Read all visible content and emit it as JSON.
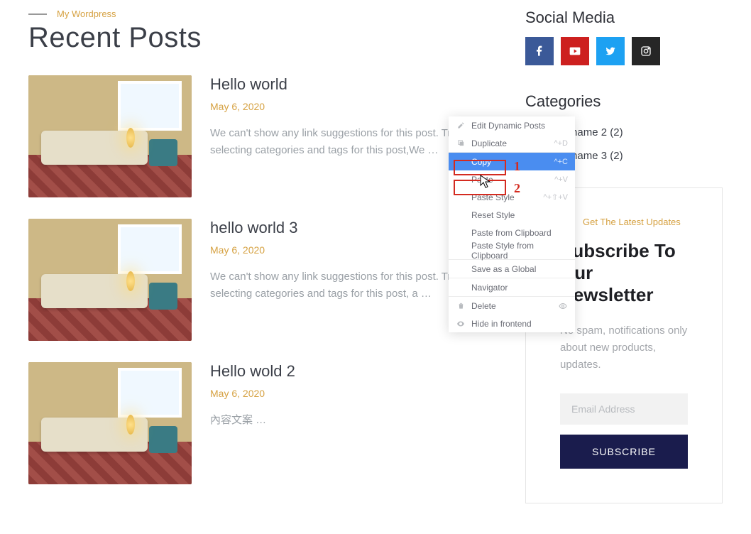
{
  "header": {
    "eyebrow": "My Wordpress",
    "title": "Recent Posts"
  },
  "posts": [
    {
      "title": "Hello world",
      "date": "May 6, 2020",
      "excerpt": "We can't show any link suggestions for this post. Try selecting categories and tags for this post,We …"
    },
    {
      "title": "hello world 3",
      "date": "May 6, 2020",
      "excerpt": "We can't show any link suggestions for this post. Try selecting categories and tags for this post, a …"
    },
    {
      "title": "Hello wold 2",
      "date": "May 6, 2020",
      "excerpt": "內容文案 …"
    }
  ],
  "sidebar": {
    "social_title": "Social Media",
    "categories_title": "Categories",
    "categories": [
      "Category name 2 (2)",
      "Category name 3 (2)"
    ]
  },
  "newsletter": {
    "eyebrow": "Get The Latest Updates",
    "title": "Subscribe To Our Newsletter",
    "desc": "No spam, notifications only about new products, updates.",
    "placeholder": "Email Address",
    "button": "SUBSCRIBE"
  },
  "context_menu": {
    "items": [
      {
        "key": "edit",
        "label": "Edit Dynamic Posts",
        "shortcut": "",
        "icon": "pencil"
      },
      {
        "key": "duplicate",
        "label": "Duplicate",
        "shortcut": "^+D",
        "icon": "copy"
      },
      {
        "key": "copy",
        "label": "Copy",
        "shortcut": "^+C",
        "icon": "",
        "selected": true
      },
      {
        "key": "paste",
        "label": "Paste",
        "shortcut": "^+V",
        "icon": ""
      },
      {
        "key": "paste-style",
        "label": "Paste Style",
        "shortcut": "^+⇧+V",
        "icon": ""
      },
      {
        "key": "reset-style",
        "label": "Reset Style",
        "shortcut": "",
        "icon": ""
      },
      {
        "key": "paste-clipboard",
        "label": "Paste from Clipboard",
        "shortcut": "",
        "icon": ""
      },
      {
        "key": "paste-style-clipboard",
        "label": "Paste Style from Clipboard",
        "shortcut": "",
        "icon": ""
      },
      {
        "key": "save-global",
        "label": "Save as a Global",
        "shortcut": "",
        "icon": ""
      },
      {
        "key": "navigator",
        "label": "Navigator",
        "shortcut": "",
        "icon": ""
      },
      {
        "key": "delete",
        "label": "Delete",
        "shortcut": "",
        "icon": "trash",
        "trail": "eye"
      },
      {
        "key": "hide",
        "label": "Hide in frontend",
        "shortcut": "",
        "icon": "eye-open"
      }
    ]
  },
  "annotations": {
    "n1": "1",
    "n2": "2"
  }
}
